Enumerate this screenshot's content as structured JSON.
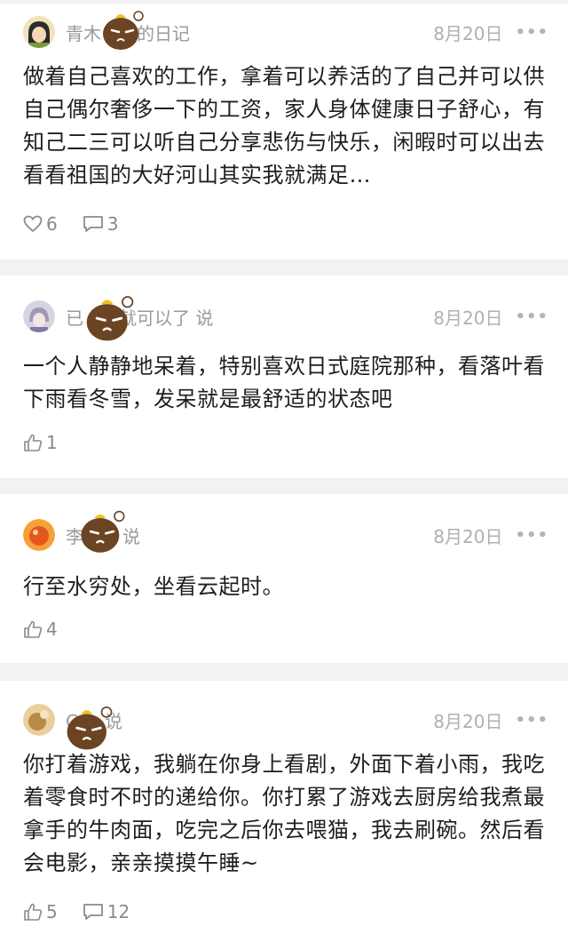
{
  "posts": [
    {
      "author": "青木",
      "author_suffix": "的日记",
      "date": "8月20日",
      "more": "•••",
      "text": "做着自己喜欢的工作，拿着可以养活的了自己并可以供自己偶尔奢侈一下的工资，家人身体健康日子舒心，有知己二三可以听自己分享悲伤与快乐，闲暇时可以出去看看祖国的大好河山其实我就满足…",
      "like_icon": "heart-icon",
      "likes": "6",
      "comments": "3",
      "avatar_color": "#6a7a3a"
    },
    {
      "author": "已",
      "author_suffix": "就可以了 说",
      "date": "8月20日",
      "more": "•••",
      "text": "一个人静静地呆着，特别喜欢日式庭院那种，看落叶看下雨看冬雪，发呆就是最舒适的状态吧",
      "like_icon": "thumb-up-icon",
      "likes": "1",
      "avatar_color": "#b9b4c8"
    },
    {
      "author": "李",
      "author_suffix": "说",
      "date": "8月20日",
      "more": "•••",
      "text": "行至水穷处，坐看云起时。",
      "like_icon": "thumb-up-icon",
      "likes": "4",
      "avatar_color": "#f0862a"
    },
    {
      "author": "C",
      "author_suffix": "说",
      "date": "8月20日",
      "more": "•••",
      "text": "你打着游戏，我躺在你身上看剧，外面下着小雨，我吃着零食时不时的递给你。你打累了游戏去厨房给我煮最拿手的牛肉面，吃完之后你去喂猫，我去刷碗。然后看会电影，亲亲摸摸午睡~",
      "like_icon": "thumb-up-icon",
      "likes": "5",
      "comments": "12",
      "avatar_color": "#caa36a"
    }
  ]
}
